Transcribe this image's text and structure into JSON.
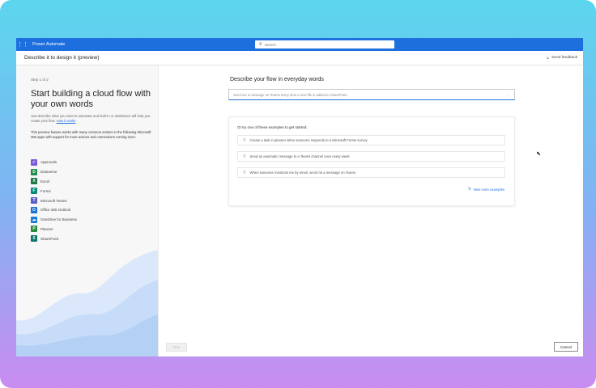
{
  "app": {
    "name": "Power Automate",
    "search_placeholder": "Search"
  },
  "header": {
    "title": "Describe it to design it (preview)",
    "feedback_label": "Send feedback"
  },
  "sidebar": {
    "step": "Step 1 of 2",
    "heading": "Start building a cloud flow with your own words",
    "description": "Just describe what you want to automate and built-in AI assistance will help you create your flow.",
    "description_link": "How it works",
    "preview_note": "This preview feature works with many common actions in the following Microsoft 365 apps with support for more actions and connections coming soon:",
    "connectors": [
      {
        "label": "Approvals",
        "color": "#7b5cd6",
        "icon": "approvals-icon",
        "glyph": "✓"
      },
      {
        "label": "Dataverse",
        "color": "#1f8a4c",
        "icon": "dataverse-icon",
        "glyph": "D"
      },
      {
        "label": "Excel",
        "color": "#1d7a45",
        "icon": "excel-icon",
        "glyph": "X"
      },
      {
        "label": "Forms",
        "color": "#0b8a7a",
        "icon": "forms-icon",
        "glyph": "F"
      },
      {
        "label": "Microsoft Teams",
        "color": "#5b5fc7",
        "icon": "teams-icon",
        "glyph": "T"
      },
      {
        "label": "Office 365 Outlook",
        "color": "#1a6fd1",
        "icon": "outlook-icon",
        "glyph": "O"
      },
      {
        "label": "OneDrive for Business",
        "color": "#1c7bd8",
        "icon": "onedrive-icon",
        "glyph": "☁"
      },
      {
        "label": "Planner",
        "color": "#2c8a3c",
        "icon": "planner-icon",
        "glyph": "P"
      },
      {
        "label": "SharePoint",
        "color": "#077568",
        "icon": "sharepoint-icon",
        "glyph": "S"
      }
    ]
  },
  "main": {
    "prompt_title": "Describe your flow in everyday words",
    "prompt_placeholder": "Send me a message on Teams every time a new file is added to SharePoint",
    "examples_title": "Or try one of these examples to get started:",
    "examples": [
      "Create a task in planner when someone responds to a Microsoft Forms survey",
      "Send an automatic message to a Teams channel once every week",
      "When someone mentions me by email, send me a message on Teams"
    ],
    "view_more": "View more examples"
  },
  "footer": {
    "start_label": "Start",
    "cancel_label": "Cancel"
  },
  "colors": {
    "brand": "#1d6fde",
    "frame_top": "#5cd6ee",
    "frame_bottom": "#c98cf0"
  }
}
